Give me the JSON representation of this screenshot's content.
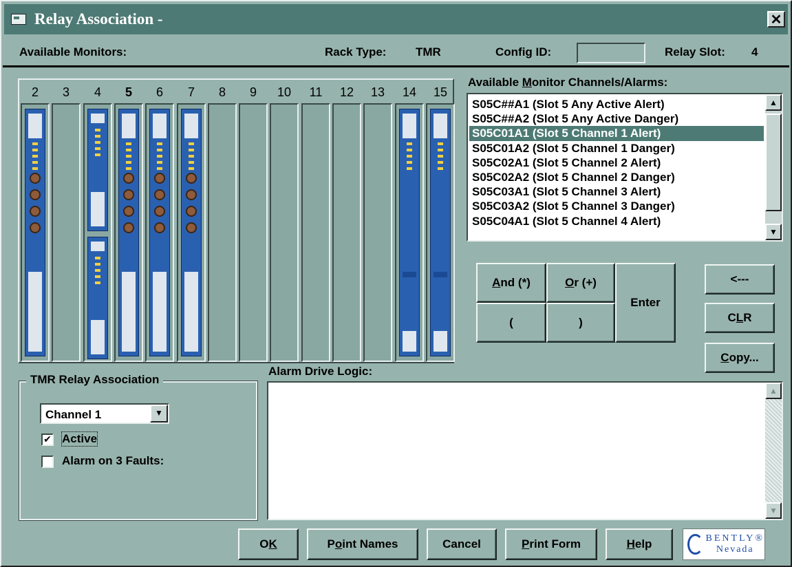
{
  "window": {
    "title": "Relay Association -",
    "close_glyph": "✕"
  },
  "info": {
    "available_monitors_label": "Available Monitors:",
    "rack_type_label": "Rack Type:",
    "rack_type_value": "TMR",
    "config_id_label": "Config ID:",
    "config_id_value": "",
    "relay_slot_label": "Relay Slot:",
    "relay_slot_value": "4"
  },
  "rack": {
    "slot_numbers": [
      "2",
      "3",
      "4",
      "5",
      "6",
      "7",
      "8",
      "9",
      "10",
      "11",
      "12",
      "13",
      "14",
      "15"
    ],
    "selected_slot": "5"
  },
  "channels": {
    "label_pre": "Available ",
    "label_accel": "M",
    "label_post": "onitor Channels/Alarms:",
    "items": [
      "S05C##A1 (Slot 5 Any Active Alert)",
      "S05C##A2 (Slot 5 Any Active Danger)",
      "S05C01A1 (Slot 5 Channel 1 Alert)",
      "S05C01A2 (Slot 5 Channel 1 Danger)",
      "S05C02A1 (Slot 5 Channel 2 Alert)",
      "S05C02A2 (Slot 5 Channel 2 Danger)",
      "S05C03A1 (Slot 5 Channel 3 Alert)",
      "S05C03A2 (Slot 5 Channel 3 Danger)",
      "S05C04A1 (Slot 5 Channel 4 Alert)"
    ],
    "selected_index": 2
  },
  "logic_buttons": {
    "and_accel": "A",
    "and_rest": "nd (*)",
    "or_accel": "O",
    "or_rest": "r (+)",
    "open_paren": "(",
    "close_paren": ")",
    "enter": "Enter"
  },
  "side_buttons": {
    "back": "<---",
    "clr_pre": "C",
    "clr_accel": "L",
    "clr_post": "R",
    "copy_accel": "C",
    "copy_rest": "opy..."
  },
  "tmr": {
    "group_title": "TMR Relay Association",
    "channel_select": "Channel 1",
    "active_label": "Active",
    "active_checked": true,
    "faults_label": "Alarm on 3 Faults:",
    "faults_checked": false
  },
  "logic": {
    "label": "Alarm Drive Logic:",
    "text": ""
  },
  "footer": {
    "ok_pre": "O",
    "ok_accel": "K",
    "point_pre": "P",
    "point_accel": "o",
    "point_post": "int Names",
    "cancel": "Cancel",
    "print_accel": "P",
    "print_rest": "rint Form",
    "help_accel": "H",
    "help_rest": "elp"
  },
  "logo": {
    "line1": "BENTLY®",
    "line2": "Nevada"
  },
  "colors": {
    "title_bar": "#4d7a74",
    "face": "#97b3ad",
    "card_blue": "#2a60b0",
    "selection": "#4d7a74"
  }
}
